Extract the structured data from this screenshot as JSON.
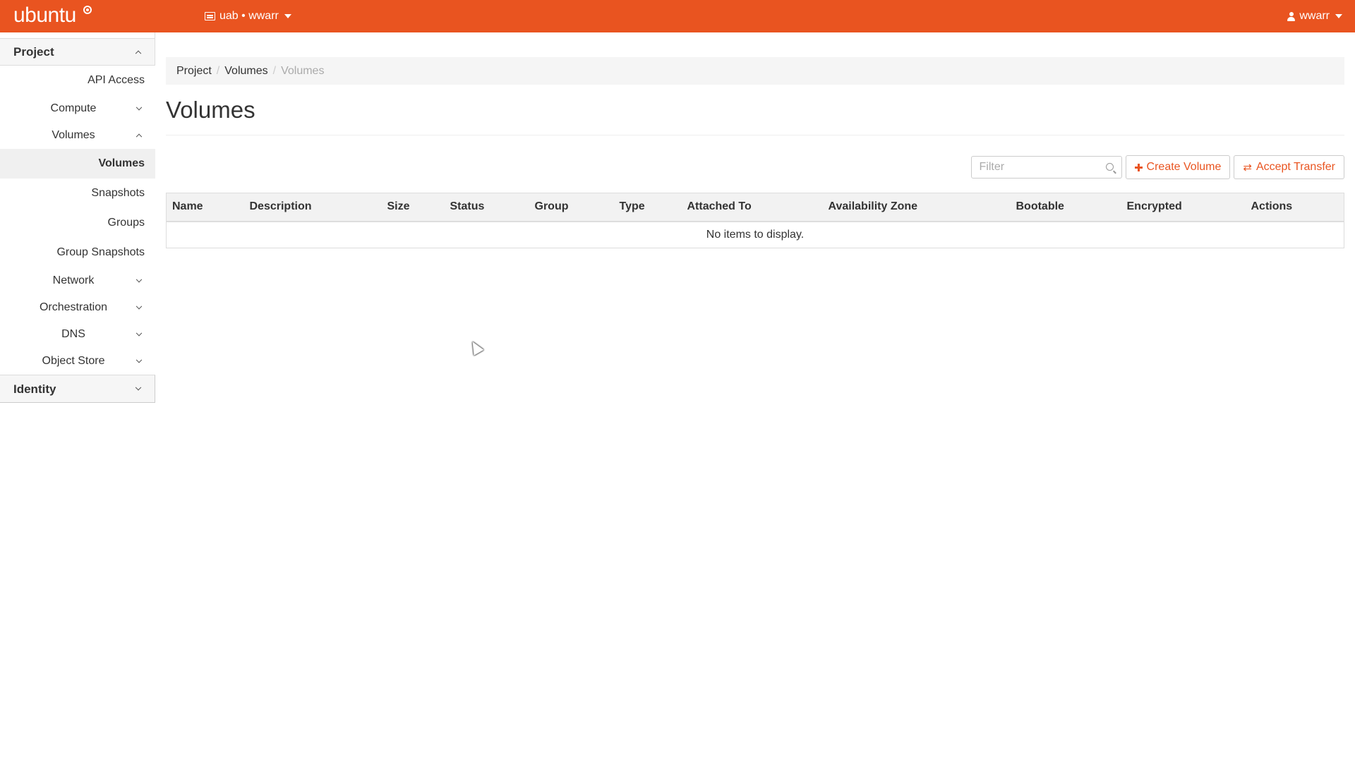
{
  "header": {
    "brand": "ubuntu",
    "project_switcher": "uab • wwarr",
    "user": "wwarr",
    "accent_color": "#e95420"
  },
  "sidebar": {
    "project_label": "Project",
    "items": [
      {
        "label": "API Access"
      },
      {
        "label": "Compute"
      },
      {
        "label": "Volumes"
      },
      {
        "label": "Volumes"
      },
      {
        "label": "Snapshots"
      },
      {
        "label": "Groups"
      },
      {
        "label": "Group Snapshots"
      },
      {
        "label": "Network"
      },
      {
        "label": "Orchestration"
      },
      {
        "label": "DNS"
      },
      {
        "label": "Object Store"
      }
    ],
    "identity_label": "Identity"
  },
  "breadcrumb": {
    "items": [
      "Project",
      "Volumes",
      "Volumes"
    ],
    "separator": "/"
  },
  "page": {
    "title": "Volumes"
  },
  "toolbar": {
    "filter_placeholder": "Filter",
    "create_label": "Create Volume",
    "accept_label": "Accept Transfer"
  },
  "table": {
    "columns": [
      "Name",
      "Description",
      "Size",
      "Status",
      "Group",
      "Type",
      "Attached To",
      "Availability Zone",
      "Bootable",
      "Encrypted",
      "Actions"
    ],
    "empty_message": "No items to display."
  }
}
